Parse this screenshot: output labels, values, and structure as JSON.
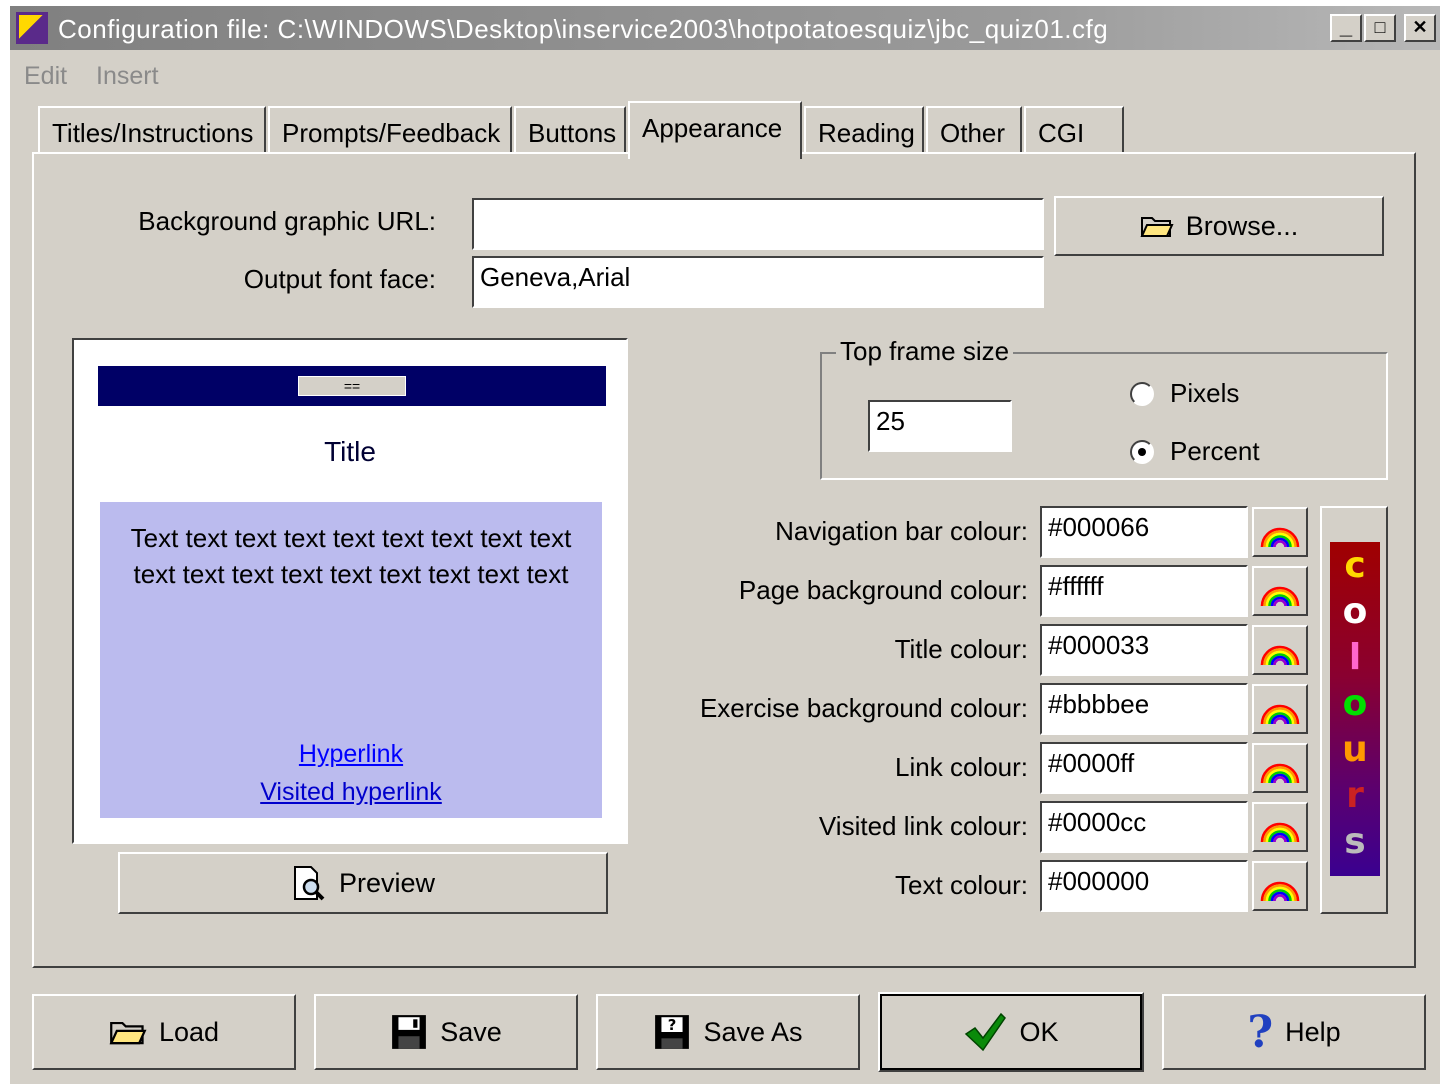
{
  "window": {
    "title": "Configuration file: C:\\WINDOWS\\Desktop\\inservice2003\\hotpotatoesquiz\\jbc_quiz01.cfg",
    "min": "_",
    "max": "□",
    "close": "✕"
  },
  "menu": [
    "Edit",
    "Insert"
  ],
  "tabs": [
    "Titles/Instructions",
    "Prompts/Feedback",
    "Buttons",
    "Appearance",
    "Reading",
    "Other",
    "CGI"
  ],
  "active_tab": "Appearance",
  "form": {
    "bg_url_label": "Background graphic URL:",
    "bg_url_value": "",
    "font_label": "Output font face:",
    "font_value": "Geneva,Arial",
    "browse": "Browse..."
  },
  "preview": {
    "nav_button": "==",
    "title": "Title",
    "body": "Text text text text text text text text text text text text text text text text text text",
    "link": "Hyperlink",
    "visited": "Visited hyperlink",
    "button": "Preview"
  },
  "frame": {
    "label": "Top frame size",
    "value": "25",
    "pixels": "Pixels",
    "percent": "Percent",
    "selected": "Percent"
  },
  "colours": [
    {
      "label": "Navigation bar colour:",
      "value": "#000066"
    },
    {
      "label": "Page background colour:",
      "value": "#ffffff"
    },
    {
      "label": "Title colour:",
      "value": "#000033"
    },
    {
      "label": "Exercise background colour:",
      "value": "#bbbbee"
    },
    {
      "label": "Link colour:",
      "value": "#0000ff"
    },
    {
      "label": "Visited link colour:",
      "value": "#0000cc"
    },
    {
      "label": "Text colour:",
      "value": "#000000"
    }
  ],
  "colours_button": [
    "c",
    "o",
    "l",
    "o",
    "u",
    "r",
    "s"
  ],
  "bottom_buttons": {
    "load": "Load",
    "save": "Save",
    "save_as": "Save As",
    "ok": "OK",
    "help": "Help"
  }
}
